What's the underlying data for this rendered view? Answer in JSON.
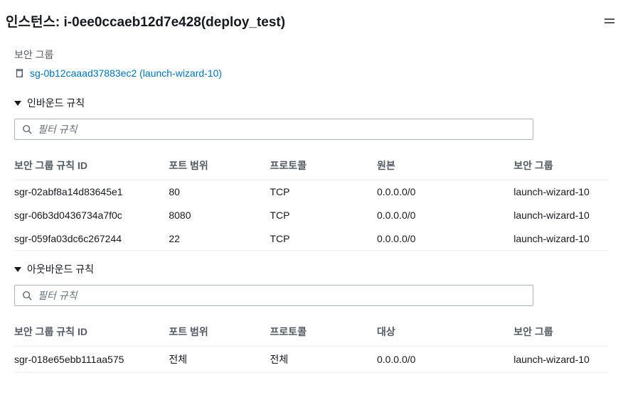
{
  "header": {
    "title": "인스턴스: i-0ee0ccaeb12d7e428(deploy_test)"
  },
  "securityGroup": {
    "label": "보안 그룹",
    "linkText": "sg-0b12caaad37883ec2 (launch-wizard-10)"
  },
  "inbound": {
    "title": "인바운드 규칙",
    "filterPlaceholder": "필터 규칙",
    "columns": {
      "id": "보안 그룹 규칙 ID",
      "port": "포트 범위",
      "protocol": "프로토콜",
      "source": "원본",
      "sg": "보안 그룹"
    },
    "rows": [
      {
        "id": "sgr-02abf8a14d83645e1",
        "port": "80",
        "protocol": "TCP",
        "source": "0.0.0.0/0",
        "sg": "launch-wizard-10"
      },
      {
        "id": "sgr-06b3d0436734a7f0c",
        "port": "8080",
        "protocol": "TCP",
        "source": "0.0.0.0/0",
        "sg": "launch-wizard-10"
      },
      {
        "id": "sgr-059fa03dc6c267244",
        "port": "22",
        "protocol": "TCP",
        "source": "0.0.0.0/0",
        "sg": "launch-wizard-10"
      }
    ]
  },
  "outbound": {
    "title": "아웃바운드 규칙",
    "filterPlaceholder": "필터 규칙",
    "columns": {
      "id": "보안 그룹 규칙 ID",
      "port": "포트 범위",
      "protocol": "프로토콜",
      "dest": "대상",
      "sg": "보안 그룹"
    },
    "rows": [
      {
        "id": "sgr-018e65ebb111aa575",
        "port": "전체",
        "protocol": "전체",
        "dest": "0.0.0.0/0",
        "sg": "launch-wizard-10"
      }
    ]
  }
}
